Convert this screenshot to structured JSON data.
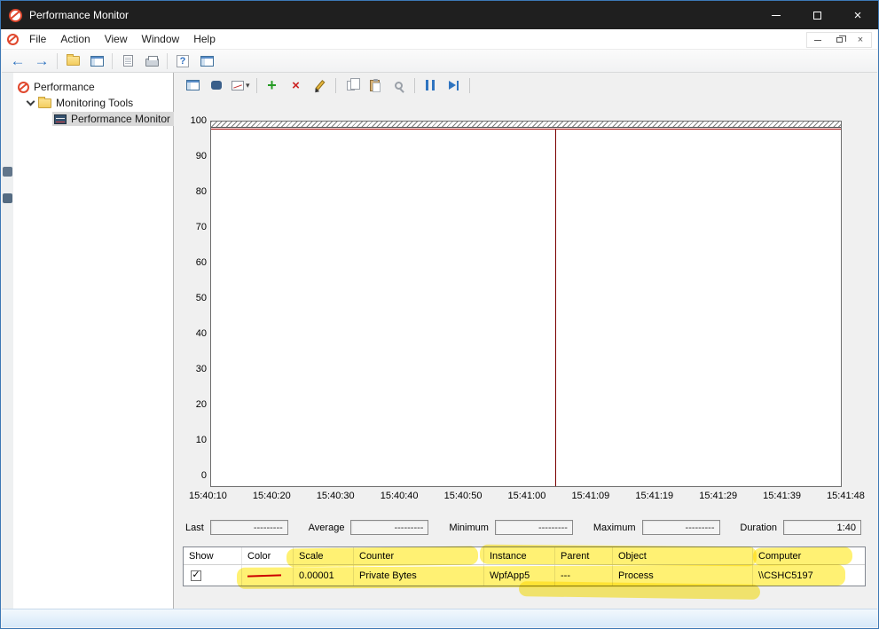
{
  "window": {
    "title": "Performance Monitor"
  },
  "menu": {
    "items": [
      "File",
      "Action",
      "View",
      "Window",
      "Help"
    ]
  },
  "toolbar": {
    "icons": [
      "back",
      "forward",
      "up-folder",
      "console-tree",
      "export-list",
      "print",
      "help",
      "show-console"
    ]
  },
  "tree": {
    "root_label": "Performance",
    "items": [
      {
        "label": "Monitoring Tools"
      },
      {
        "label": "Performance Monitor",
        "selected": true
      }
    ]
  },
  "graph_toolbar": {
    "icons": [
      "view-current-activity",
      "view-log-data",
      "change-graph-type",
      "add-counter",
      "delete-counter",
      "highlight",
      "copy-properties",
      "paste-counter-list",
      "zoom",
      "freeze-display",
      "update-data"
    ]
  },
  "chart": {
    "y_ticks": [
      "100",
      "90",
      "80",
      "70",
      "60",
      "50",
      "40",
      "30",
      "20",
      "10",
      "0"
    ],
    "x_ticks": [
      "15:40:10",
      "15:40:20",
      "15:40:30",
      "15:40:40",
      "15:40:50",
      "15:41:00",
      "15:41:09",
      "15:41:19",
      "15:41:29",
      "15:41:39",
      "15:41:48"
    ],
    "counter_line_color": "#a00000",
    "timeline_marker_color": "#7b0000"
  },
  "stats": {
    "last_label": "Last",
    "last_value": "---------",
    "average_label": "Average",
    "average_value": "---------",
    "minimum_label": "Minimum",
    "minimum_value": "---------",
    "maximum_label": "Maximum",
    "maximum_value": "---------",
    "duration_label": "Duration",
    "duration_value": "1:40"
  },
  "counter_table": {
    "headers": [
      "Show",
      "Color",
      "Scale",
      "Counter",
      "Instance",
      "Parent",
      "Object",
      "Computer"
    ],
    "row": {
      "show_checked": true,
      "color": "#cc0000",
      "scale": "0.00001",
      "counter": "Private Bytes",
      "instance": "WpfApp5",
      "parent": "---",
      "object": "Process",
      "computer": "\\\\CSHC5197"
    }
  },
  "annotations": {
    "highlighter_color": "#ffe600"
  }
}
